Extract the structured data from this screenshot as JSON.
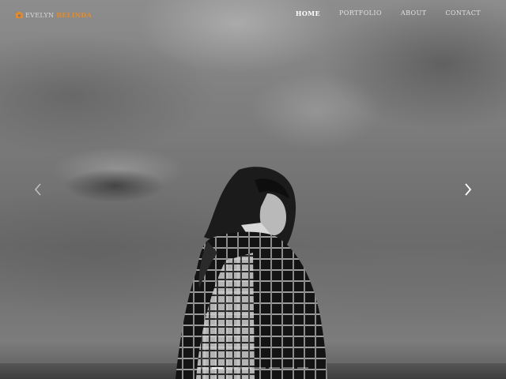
{
  "brand": {
    "first_name": "EVELYN",
    "last_name": "BELINDA",
    "icon": "camera-icon",
    "accent_color": "#e88a24"
  },
  "nav": {
    "items": [
      {
        "label": "HOME",
        "active": true
      },
      {
        "label": "PORTFOLIO",
        "active": false
      },
      {
        "label": "ABOUT",
        "active": false
      },
      {
        "label": "CONTACT",
        "active": false
      }
    ]
  },
  "slider": {
    "prev_icon": "chevron-left-icon",
    "next_icon": "chevron-right-icon",
    "slide_count": 8,
    "active_index": 1
  }
}
